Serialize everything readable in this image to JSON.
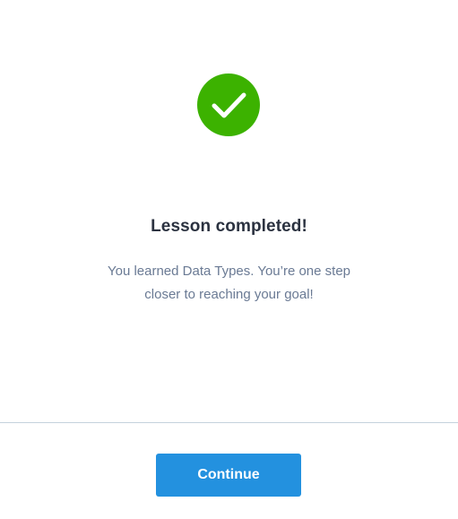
{
  "lesson": {
    "status_icon": "checkmark-icon",
    "title": "Lesson completed!",
    "message_line1": "You learned Data Types. You’re one step",
    "message_line2": "closer to reaching your goal!"
  },
  "footer": {
    "continue_label": "Continue"
  },
  "colors": {
    "success": "#3cb200",
    "primary_button": "#2391df",
    "title_text": "#2b3240",
    "body_text": "#6a7a94",
    "divider": "#c4d2dc"
  }
}
